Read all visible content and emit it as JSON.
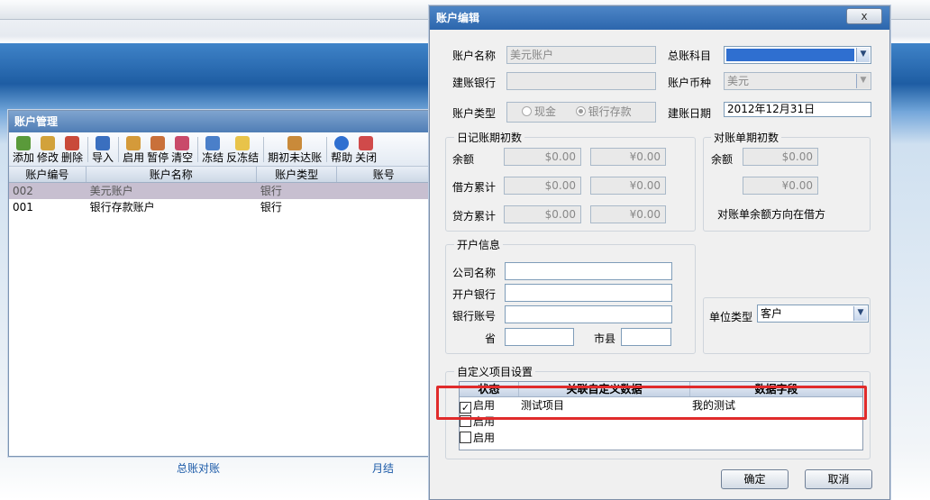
{
  "account_window": {
    "title": "账户管理",
    "toolbar": [
      "添加",
      "修改",
      "删除",
      "导入",
      "启用",
      "暂停",
      "清空",
      "冻结",
      "反冻结",
      "期初未达账",
      "帮助",
      "关闭"
    ],
    "columns": [
      "账户编号",
      "账户名称",
      "账户类型",
      "账号"
    ],
    "rows": [
      {
        "code": "002",
        "name": "美元账户",
        "type": "银行",
        "selected": true
      },
      {
        "code": "001",
        "name": "银行存款账户",
        "type": "银行",
        "selected": false
      }
    ],
    "links": [
      "总账对账",
      "月结"
    ]
  },
  "dialog": {
    "title": "账户编辑",
    "close": "x",
    "labels": {
      "name": "账户名称",
      "ledger": "总账科目",
      "bank": "建账银行",
      "currency": "账户币种",
      "type": "账户类型",
      "date": "建账日期"
    },
    "values": {
      "name": "美元账户",
      "ledger": "",
      "bank": "",
      "currency": "美元",
      "date": "2012年12月31日"
    },
    "account_type": {
      "cash": "现金",
      "bank_deposit": "银行存款"
    },
    "journal": {
      "title": "日记账期初数",
      "rows": [
        {
          "label": "余额",
          "a": "$0.00",
          "b": "¥0.00"
        },
        {
          "label": "借方累计",
          "a": "$0.00",
          "b": "¥0.00"
        },
        {
          "label": "贷方累计",
          "a": "$0.00",
          "b": "¥0.00"
        }
      ]
    },
    "reconcile": {
      "title": "对账单期初数",
      "label": "余额",
      "a": "$0.00",
      "b": "¥0.00",
      "note": "对账单余额方向在借方"
    },
    "opening": {
      "title": "开户信息",
      "company": "公司名称",
      "bank": "开户银行",
      "account": "银行账号",
      "province": "省",
      "city": "市县",
      "unit_type_label": "单位类型",
      "unit_type": "客户"
    },
    "custom": {
      "title": "自定义项目设置",
      "columns": [
        "状态",
        "关联自定义数据",
        "数据字段"
      ],
      "rows": [
        {
          "status": "启用",
          "checked": true,
          "data": "测试项目",
          "field": "我的测试"
        },
        {
          "status": "启用",
          "checked": false,
          "data": "",
          "field": ""
        },
        {
          "status": "启用",
          "checked": false,
          "data": "",
          "field": ""
        }
      ]
    },
    "ok": "确定",
    "cancel": "取消"
  }
}
